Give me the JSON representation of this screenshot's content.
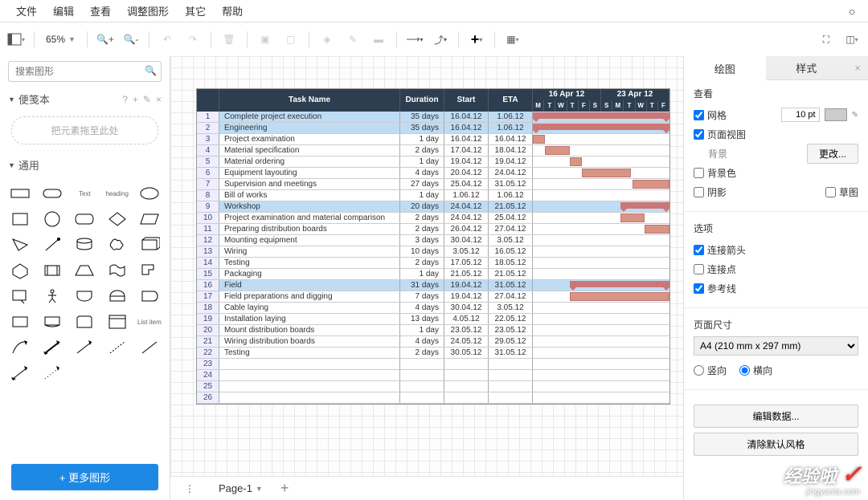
{
  "menu": [
    "文件",
    "编辑",
    "查看",
    "调整图形",
    "其它",
    "帮助"
  ],
  "zoom": "65%",
  "search_placeholder": "搜索图形",
  "scratchpad": {
    "title": "便笺本",
    "drop_hint": "把元素拖至此处"
  },
  "general_title": "通用",
  "more_shapes": "+ 更多图形",
  "page_tab": "Page-1",
  "gantt": {
    "columns": {
      "task": "Task Name",
      "duration": "Duration",
      "start": "Start",
      "eta": "ETA"
    },
    "weeks": [
      "16 Apr 12",
      "23 Apr 12"
    ],
    "days": [
      "M",
      "T",
      "W",
      "T",
      "F",
      "S",
      "S",
      "M",
      "T",
      "W",
      "T",
      "F"
    ],
    "rows": [
      {
        "n": 1,
        "name": "Complete project execution",
        "dur": "35 days",
        "start": "16.04.12",
        "eta": "1.06.12",
        "blue": true,
        "bar": [
          0,
          100,
          true
        ]
      },
      {
        "n": 2,
        "name": "Engineering",
        "dur": "35 days",
        "start": "16.04.12",
        "eta": "1.06.12",
        "blue": true,
        "bar": [
          0,
          100,
          true
        ]
      },
      {
        "n": 3,
        "name": "Project examination",
        "dur": "1 day",
        "start": "16.04.12",
        "eta": "16.04.12",
        "bar": [
          0,
          9
        ]
      },
      {
        "n": 4,
        "name": "Material specification",
        "dur": "2 days",
        "start": "17.04.12",
        "eta": "18.04.12",
        "bar": [
          9,
          18
        ]
      },
      {
        "n": 5,
        "name": "Material ordering",
        "dur": "1 day",
        "start": "19.04.12",
        "eta": "19.04.12",
        "bar": [
          27,
          9
        ]
      },
      {
        "n": 6,
        "name": "Equipment layouting",
        "dur": "4 days",
        "start": "20.04.12",
        "eta": "24.04.12",
        "bar": [
          36,
          36
        ]
      },
      {
        "n": 7,
        "name": "Supervision and meetings",
        "dur": "27 days",
        "start": "25.04.12",
        "eta": "31.05.12",
        "bar": [
          73,
          27
        ]
      },
      {
        "n": 8,
        "name": "Bill of works",
        "dur": "1 day",
        "start": "1.06.12",
        "eta": "1.06.12"
      },
      {
        "n": 9,
        "name": "Workshop",
        "dur": "20 days",
        "start": "24.04.12",
        "eta": "21.05.12",
        "blue": true,
        "bar": [
          64,
          36,
          true
        ]
      },
      {
        "n": 10,
        "name": "Project examination and material comparison",
        "dur": "2 days",
        "start": "24.04.12",
        "eta": "25.04.12",
        "bar": [
          64,
          18
        ]
      },
      {
        "n": 11,
        "name": "Preparing distribution boards",
        "dur": "2 days",
        "start": "26.04.12",
        "eta": "27.04.12",
        "bar": [
          82,
          18
        ]
      },
      {
        "n": 12,
        "name": "Mounting equipment",
        "dur": "3 days",
        "start": "30.04.12",
        "eta": "3.05.12"
      },
      {
        "n": 13,
        "name": "Wiring",
        "dur": "10 days",
        "start": "3.05.12",
        "eta": "16.05.12"
      },
      {
        "n": 14,
        "name": "Testing",
        "dur": "2 days",
        "start": "17.05.12",
        "eta": "18.05.12"
      },
      {
        "n": 15,
        "name": "Packaging",
        "dur": "1 day",
        "start": "21.05.12",
        "eta": "21.05.12"
      },
      {
        "n": 16,
        "name": "Field",
        "dur": "31 days",
        "start": "19.04.12",
        "eta": "31.05.12",
        "blue": true,
        "bar": [
          27,
          73,
          true
        ]
      },
      {
        "n": 17,
        "name": "Field preparations and digging",
        "dur": "7 days",
        "start": "19.04.12",
        "eta": "27.04.12",
        "bar": [
          27,
          73
        ]
      },
      {
        "n": 18,
        "name": "Cable laying",
        "dur": "4 days",
        "start": "30.04.12",
        "eta": "3.05.12"
      },
      {
        "n": 19,
        "name": "Installation laying",
        "dur": "13 days",
        "start": "4.05.12",
        "eta": "22.05.12"
      },
      {
        "n": 20,
        "name": "Mount distribution boards",
        "dur": "1 day",
        "start": "23.05.12",
        "eta": "23.05.12"
      },
      {
        "n": 21,
        "name": "Wiring distribution boards",
        "dur": "4 days",
        "start": "24.05.12",
        "eta": "29.05.12"
      },
      {
        "n": 22,
        "name": "Testing",
        "dur": "2 days",
        "start": "30.05.12",
        "eta": "31.05.12"
      },
      {
        "n": 23,
        "name": "",
        "dur": "",
        "start": "",
        "eta": ""
      },
      {
        "n": 24,
        "name": "",
        "dur": "",
        "start": "",
        "eta": ""
      },
      {
        "n": 25,
        "name": "",
        "dur": "",
        "start": "",
        "eta": ""
      },
      {
        "n": 26,
        "name": "",
        "dur": "",
        "start": "",
        "eta": ""
      }
    ]
  },
  "right_panel": {
    "tabs": {
      "draw": "绘图",
      "style": "样式"
    },
    "view_title": "查看",
    "grid": "网格",
    "grid_size": "10 pt",
    "page_view": "页面视图",
    "background": "背景",
    "change": "更改...",
    "bg_color": "背景色",
    "shadow": "阴影",
    "sketch": "草图",
    "options_title": "选项",
    "conn_arrows": "连接箭头",
    "conn_points": "连接点",
    "guides": "参考线",
    "page_size_title": "页面尺寸",
    "page_size": "A4 (210 mm x 297 mm)",
    "portrait": "竖向",
    "landscape": "横向",
    "edit_data": "编辑数据...",
    "clear_style": "清除默认风格"
  },
  "watermark": {
    "main": "经验啦",
    "check": "✓",
    "sub": "jingyanla.com"
  }
}
